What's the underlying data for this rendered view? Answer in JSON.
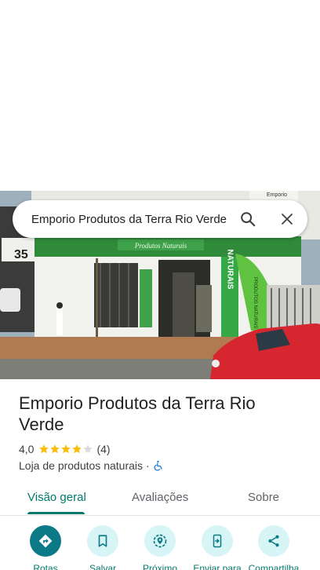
{
  "search": {
    "query": "Emporio Produtos da Terra Rio Verde"
  },
  "hero": {
    "photo_subject": "storefront photo",
    "sign_text": "Produtos Naturais",
    "side_sign_text": "NATURAIS",
    "pillar_text": "PRODUTOS",
    "flag_text": "PRODUTOS NATURAIS",
    "corner_sign": "Emporio",
    "left_sign_number": "35"
  },
  "place": {
    "name": "Emporio Produtos da Terra Rio Verde",
    "rating": "4,0",
    "rating_value": 4.0,
    "review_count": "(4)",
    "category": "Loja de produtos naturais",
    "separator": "·",
    "accessibility_icon": "wheelchair-icon"
  },
  "tabs": [
    {
      "label": "Visão geral",
      "active": true
    },
    {
      "label": "Avaliações",
      "active": false
    },
    {
      "label": "Sobre",
      "active": false
    }
  ],
  "actions": [
    {
      "label": "Rotas",
      "icon": "directions-icon"
    },
    {
      "label": "Salvar",
      "icon": "bookmark-icon"
    },
    {
      "label": "Próximo",
      "icon": "nearby-icon"
    },
    {
      "label": "Enviar para",
      "icon": "send-to-phone-icon"
    },
    {
      "label": "Compartilha",
      "icon": "share-icon"
    }
  ],
  "colors": {
    "accent": "#00796b",
    "primary_action": "#0b7a86",
    "action_bg": "#d7f5f7",
    "star": "#fbbc04",
    "star_empty": "#dadce0",
    "accessibility": "#1a73e8"
  }
}
